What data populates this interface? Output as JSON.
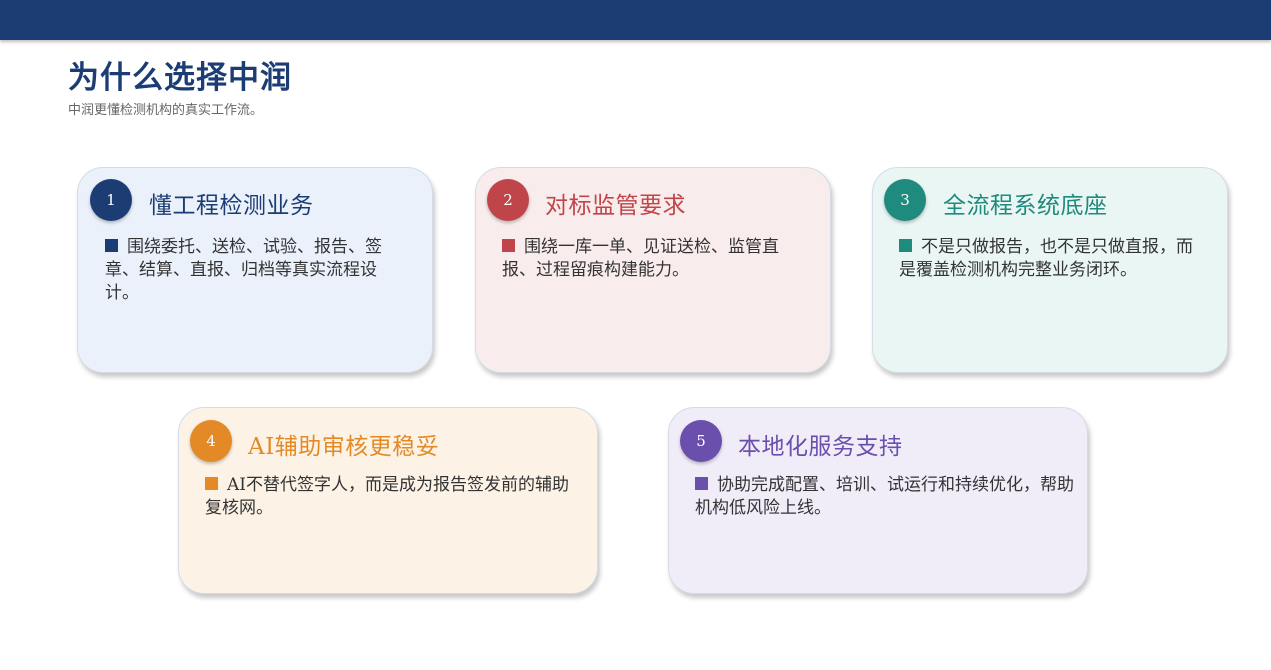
{
  "page": {
    "title": "为什么选择中润",
    "subtitle": "中润更懂检测机构的真实工作流。"
  },
  "cards": [
    {
      "number": "1",
      "title": "懂工程检测业务",
      "text": "围绕委托、送检、试验、报告、签章、结算、直报、归档等真实流程设计。",
      "accent_color": "#1c3d74",
      "background_color": "#eaf1fb"
    },
    {
      "number": "2",
      "title": "对标监管要求",
      "text": "围绕一库一单、见证送检、监管直报、过程留痕构建能力。",
      "accent_color": "#c0454a",
      "background_color": "#f8ecec"
    },
    {
      "number": "3",
      "title": "全流程系统底座",
      "text": "不是只做报告，也不是只做直报，而是覆盖检测机构完整业务闭环。",
      "accent_color": "#1f8a7e",
      "background_color": "#e9f6f3"
    },
    {
      "number": "4",
      "title": "AI辅助审核更稳妥",
      "text": "AI不替代签字人，而是成为报告签发前的辅助复核网。",
      "accent_color": "#e38a26",
      "background_color": "#fcf3e6"
    },
    {
      "number": "5",
      "title": "本地化服务支持",
      "text": "协助完成配置、培训、试运行和持续优化，帮助机构低风险上线。",
      "accent_color": "#6a4fad",
      "background_color": "#f0ecf8"
    }
  ],
  "colors": {
    "header_bar": "#1c3d74",
    "title": "#1c3d74",
    "subtitle": "#666666",
    "body_text": "#333333"
  }
}
